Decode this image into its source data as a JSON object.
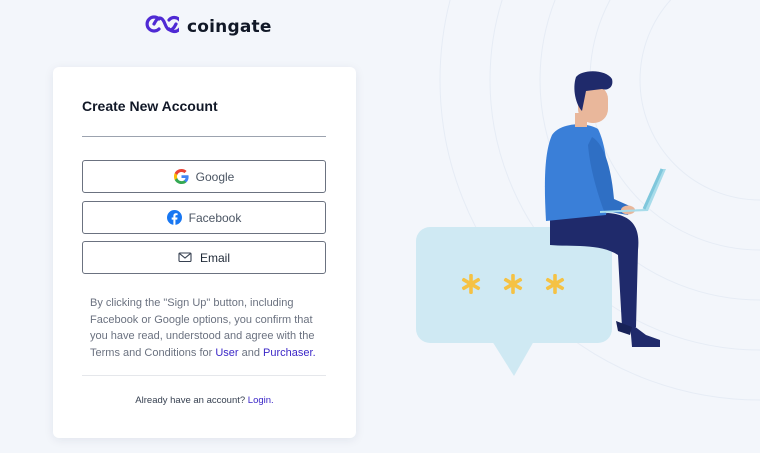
{
  "brand": {
    "name": "coingate",
    "logo_icon": "coingate-logo-icon",
    "accent_color": "#4f2ad4"
  },
  "card": {
    "title": "Create New Account",
    "buttons": [
      {
        "label": "Google",
        "icon": "google-icon"
      },
      {
        "label": "Facebook",
        "icon": "facebook-icon"
      },
      {
        "label": "Email",
        "icon": "mail-icon"
      }
    ],
    "terms": {
      "text_before": "By clicking the \"Sign Up\" button, including Facebook or Google options, you confirm that you have read, understood and agree with the Terms and Conditions for ",
      "user_link": "User",
      "conjunction": " and ",
      "purchaser_link": "Purchaser."
    },
    "footer": {
      "prompt": "Already have an account? ",
      "login_link": "Login."
    }
  },
  "colors": {
    "background": "#f3f6fb",
    "link": "#3b27c7",
    "bubble": "#cfe9f3",
    "asterisk": "#f5c244",
    "shirt": "#3a7fd8",
    "pants": "#1f2a6b"
  }
}
